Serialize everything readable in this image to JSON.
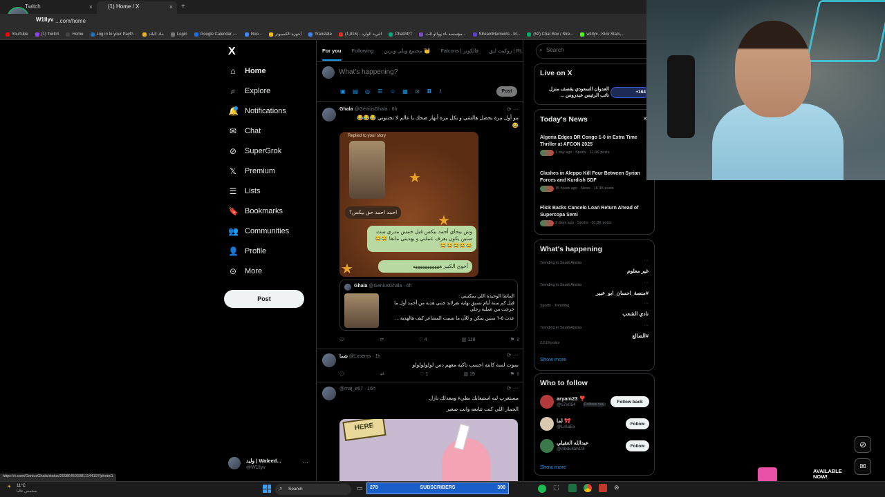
{
  "browser": {
    "tabs": [
      {
        "label": "Twitch",
        "close": "×"
      },
      {
        "label": "(1) Home / X",
        "close": "×"
      }
    ],
    "new_tab": "+",
    "profile_name": "W1llyv",
    "url": "...com/home",
    "bookmarks": [
      {
        "label": "YouTube",
        "color": "#ff0000"
      },
      {
        "label": "(1) Twitch",
        "color": "#9146ff"
      },
      {
        "label": "Home",
        "color": "#444"
      },
      {
        "label": "Log in to your PayP...",
        "color": "#1d72b8"
      },
      {
        "label": "بنك البلاد",
        "color": "#e7b12a"
      },
      {
        "label": "Login",
        "color": "#777"
      },
      {
        "label": "Google Calendar -...",
        "color": "#1a73e8"
      },
      {
        "label": "Goo...",
        "color": "#4285f4"
      },
      {
        "label": "أجهزة الكمبيوتر",
        "color": "#f0c010"
      },
      {
        "label": "Translate",
        "color": "#4285f4"
      },
      {
        "label": "البريد الوارد - (1,815)",
        "color": "#d93025"
      },
      {
        "label": "ChatGPT",
        "color": "#10a37f"
      },
      {
        "label": "مؤسسة باء ووالو للت...",
        "color": "#7a4cc2"
      },
      {
        "label": "StreamElements - M...",
        "color": "#5b3fc9"
      },
      {
        "label": "(52) Chat Box / Stre...",
        "color": "#00a86b"
      },
      {
        "label": "w1llyv - Kick Stats,...",
        "color": "#53fc18"
      }
    ],
    "status_url": "https://x.com/GeniusGhala/status/2008645030811144197/photo/1"
  },
  "nav": {
    "logo": "X",
    "items": [
      {
        "label": "Home",
        "icon": "home-icon",
        "glyph": "⌂"
      },
      {
        "label": "Explore",
        "icon": "search-icon",
        "glyph": "⌕"
      },
      {
        "label": "Notifications",
        "icon": "bell-icon",
        "glyph": "🔔"
      },
      {
        "label": "Chat",
        "icon": "mail-icon",
        "glyph": "✉"
      },
      {
        "label": "SuperGrok",
        "icon": "grok-icon",
        "glyph": "⊘"
      },
      {
        "label": "Premium",
        "icon": "x-premium-icon",
        "glyph": "𝕏"
      },
      {
        "label": "Lists",
        "icon": "list-icon",
        "glyph": "☰"
      },
      {
        "label": "Bookmarks",
        "icon": "bookmark-icon",
        "glyph": "🔖"
      },
      {
        "label": "Communities",
        "icon": "people-icon",
        "glyph": "👥"
      },
      {
        "label": "Profile",
        "icon": "person-icon",
        "glyph": "👤"
      },
      {
        "label": "More",
        "icon": "more-circle-icon",
        "glyph": "⊙"
      }
    ],
    "post_label": "Post",
    "account": {
      "name": "وليد | Waleed...",
      "handle": "@W1llyv"
    }
  },
  "feed": {
    "tabs": [
      "For you",
      "Following",
      "مجتمع وبلي وبرين 👑",
      "Falcons | فالكونز",
      "روكيت ليق | RL"
    ],
    "compose_placeholder": "What's happening?",
    "compose_post": "Post",
    "tweets": [
      {
        "name": "Ghala",
        "meta": "@GeniusGhala · 6h",
        "text_lines": [
          "مو أول مرة يحصل هالشي و بكل مرة أنهار ضحك يا عالم لا تجتنوني 😂😂😂",
          "😂"
        ],
        "story_label": "Replied to your story",
        "story_bubble1": "احمد احمد حق بيكس؟",
        "story_bubble2": "وش بيحاي أحمد بيكس قبل خمس مدري ست سنين يكون يعرف عملني و يهديني مانقا 😂😂😂😂😂😂😂",
        "story_bubble3": "أخوي الكبير هههههههههههه",
        "quote": {
          "name": "Ghala",
          "meta": "@GeniusGhala · 6h",
          "lines": [
            "المانقا الوحيدة اللي بمكتبتي :",
            "قبل كم سنة أيام تسبق نهاية نفرلاند جتني هدية من أحمد أول ما خرجت من عملية رجلي",
            "عدت ٥-٦ سنين يمكن و للآن ما نسيت المشاعر كيف هالهدية ..."
          ]
        },
        "likes": "4",
        "views": "118"
      },
      {
        "name": "شما",
        "meta": "@Lxsems · 1h",
        "text_lines": [
          "بموت لسه كانته احسب تاكيه معهم دس لولولولولو"
        ],
        "likes": "1",
        "views": "19"
      },
      {
        "name": "",
        "meta": "@maj_e67 · 16h",
        "text_lines": [
          "مستغرب ليه استيعابك بطيء ومعدلك نازل",
          "الحمار اللي كنت تتابعه وانت صغير"
        ],
        "image_sign": "HERE"
      }
    ]
  },
  "right": {
    "search_placeholder": "Search",
    "live": {
      "title": "Live on X",
      "text": "العدوان السعودي يقصف منزل نائب الرئيس عيدروس ...",
      "badge": "+164"
    },
    "news": {
      "title": "Today's News",
      "close": "×",
      "items": [
        {
          "headline": "Algeria Edges DR Congo 1-0 in Extra Time Thriller at AFCON 2025",
          "meta": "1 day ago · Sports · 11.6K posts"
        },
        {
          "headline": "Clashes in Aleppo Kill Four Between Syrian Forces and Kurdish SDF",
          "meta": "15 hours ago · News · 16.3K posts"
        },
        {
          "headline": "Flick Backs Cancelo Loan Return Ahead of Supercopa Semi",
          "meta": "2 days ago · Sports · 31.8K posts"
        }
      ]
    },
    "happening": {
      "title": "What's happening",
      "trends": [
        {
          "context": "Trending in Saudi Arabia",
          "name": "غير معلوم",
          "posts": ""
        },
        {
          "context": "Trending in Saudi Arabia",
          "name": "#منصة_احسان_ابو_عبير",
          "posts": ""
        },
        {
          "context": "Sports · Trending",
          "name": "نادي الشعب",
          "posts": ""
        },
        {
          "context": "Trending in Saudi Arabia",
          "name": "#الضالع",
          "posts": "2,519 posts"
        }
      ],
      "show_more": "Show more"
    },
    "who": {
      "title": "Who to follow",
      "people": [
        {
          "name": "aryam23 ❣️",
          "handle": "@s7x054",
          "tag": "Follows you",
          "button": "Follow back"
        },
        {
          "name": "لما 🎀",
          "handle": "@LmaEx",
          "tag": "",
          "button": "Follow"
        },
        {
          "name": "عبدالله العقيلي",
          "handle": "@Abdullah19l",
          "tag": "",
          "button": "Follow"
        }
      ],
      "show_more": "Show more"
    }
  },
  "taskbar": {
    "weather_temp": "11°C",
    "weather_desc": "مشمس غالبا",
    "search": "Search",
    "subs_left": "278",
    "subs_label": "SUBSCRIBERS",
    "subs_right": "300",
    "available": "AVAILABLE NOW!"
  }
}
